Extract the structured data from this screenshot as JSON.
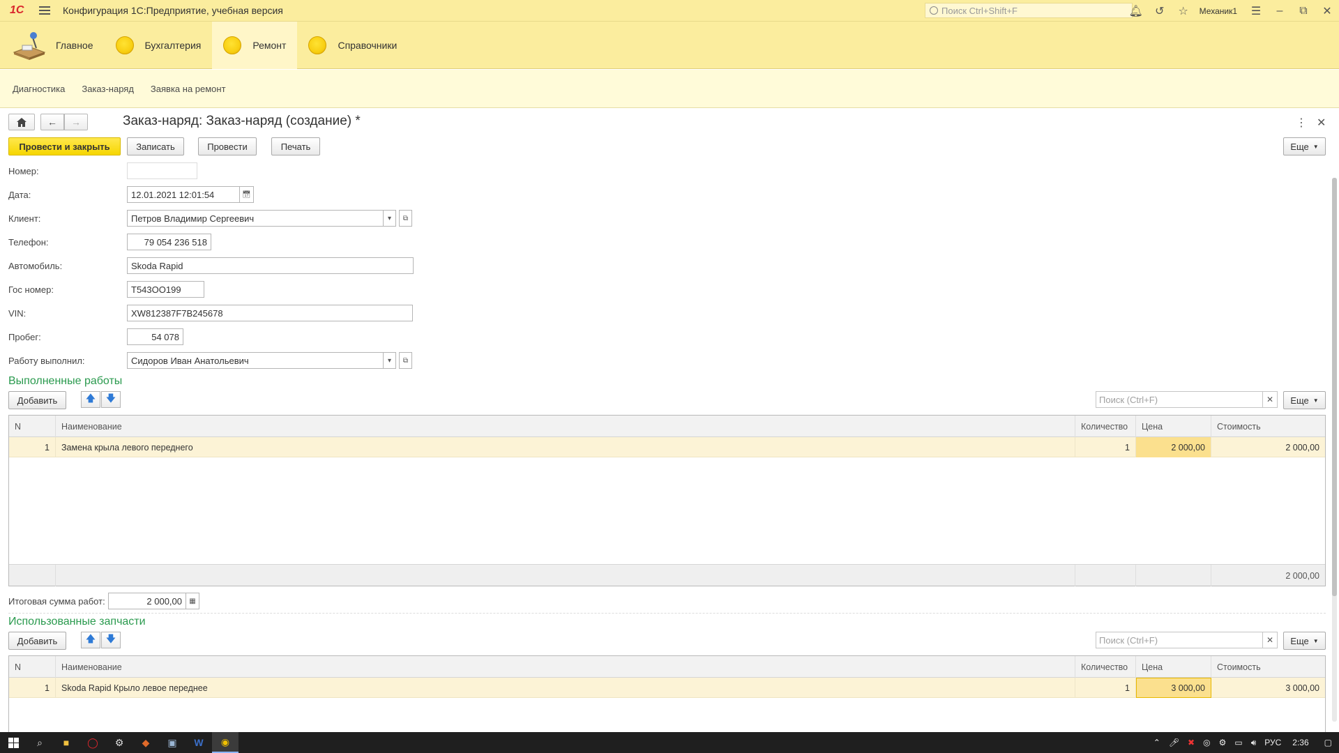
{
  "window": {
    "title": "Конфигурация 1С:Предприятие, учебная версия",
    "logo": "1С",
    "search_placeholder": "Поиск Ctrl+Shift+F",
    "user": "Механик1"
  },
  "sections": [
    {
      "label": "Главное",
      "active": false
    },
    {
      "label": "Бухгалтерия",
      "active": false
    },
    {
      "label": "Ремонт",
      "active": true
    },
    {
      "label": "Справочники",
      "active": false
    }
  ],
  "submenu": [
    "Диагностика",
    "Заказ-наряд",
    "Заявка на ремонт"
  ],
  "form": {
    "title": "Заказ-наряд: Заказ-наряд (создание) *",
    "buttons": {
      "post_close": "Провести и закрыть",
      "save": "Записать",
      "post": "Провести",
      "print": "Печать",
      "more": "Еще"
    },
    "fields": {
      "number": {
        "label": "Номер:",
        "value": ""
      },
      "date": {
        "label": "Дата:",
        "value": "12.01.2021 12:01:54"
      },
      "client": {
        "label": "Клиент:",
        "value": "Петров Владимир Сергеевич"
      },
      "phone": {
        "label": "Телефон:",
        "value": "79 054 236 518"
      },
      "car": {
        "label": "Автомобиль:",
        "value": "Skoda Rapid"
      },
      "plate": {
        "label": "Гос номер:",
        "value": "Т543ОО199"
      },
      "vin": {
        "label": "VIN:",
        "value": "XW812387F7B245678"
      },
      "mileage": {
        "label": "Пробег:",
        "value": "54 078"
      },
      "worker": {
        "label": "Работу выполнил:",
        "value": "Сидоров Иван Анатольевич"
      }
    }
  },
  "works": {
    "title": "Выполненные работы",
    "add": "Добавить",
    "search_placeholder": "Поиск (Ctrl+F)",
    "more": "Еще",
    "columns": [
      "N",
      "Наименование",
      "Количество",
      "Цена",
      "Стоимость"
    ],
    "rows": [
      {
        "n": "1",
        "name": "Замена крыла левого переднего",
        "qty": "1",
        "price": "2 000,00",
        "cost": "2 000,00"
      }
    ],
    "footer_total": "2 000,00",
    "total_label": "Итоговая сумма работ:",
    "total_value": "2 000,00"
  },
  "parts": {
    "title": "Использованные запчасти",
    "add": "Добавить",
    "search_placeholder": "Поиск (Ctrl+F)",
    "more": "Еще",
    "columns": [
      "N",
      "Наименование",
      "Количество",
      "Цена",
      "Стоимость"
    ],
    "rows": [
      {
        "n": "1",
        "name": "Skoda Rapid Крыло левое переднее",
        "qty": "1",
        "price": "3 000,00",
        "cost": "3 000,00"
      }
    ]
  },
  "taskbar": {
    "lang": "РУС",
    "time": "2:36"
  },
  "colors": {
    "header_bg": "#fbed9e",
    "accent_yellow": "#f6d600",
    "group_title": "#2a9a4e",
    "row_highlight": "#fcf3d6"
  }
}
